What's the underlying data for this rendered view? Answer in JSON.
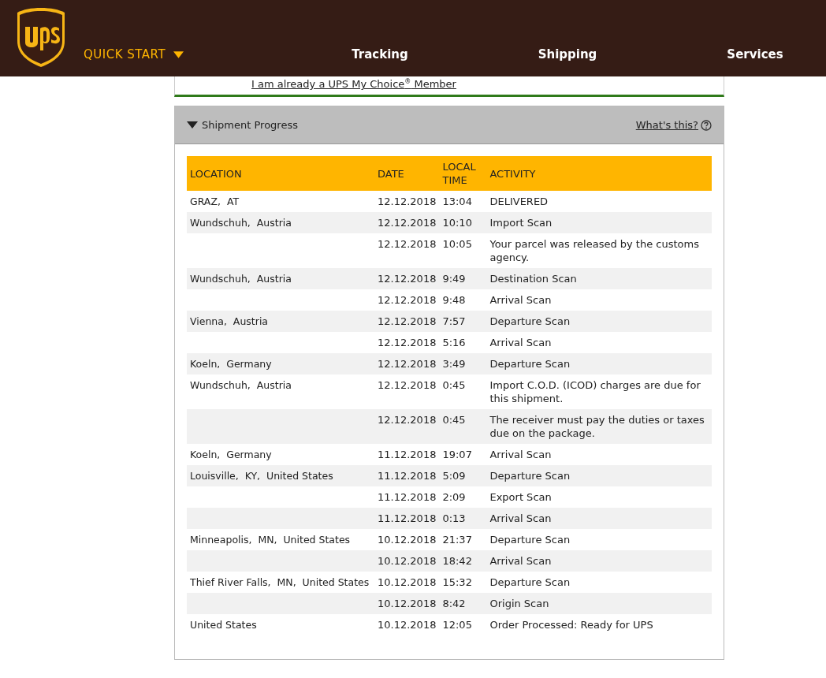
{
  "header": {
    "quick_start": "QUICK START",
    "nav": [
      {
        "label": "Tracking"
      },
      {
        "label": "Shipping"
      },
      {
        "label": "Services"
      }
    ]
  },
  "member_link": "I am already a UPS My Choice$^{®}$ Member",
  "progress": {
    "title": "Shipment Progress",
    "expanded": true,
    "help_link": "What's this?",
    "columns": [
      "LOCATION",
      "DATE",
      "LOCAL TIME",
      "ACTIVITY"
    ],
    "rows": [
      {
        "location": "GRAZ,  AT",
        "date": "12.12.2018",
        "time": "13:04",
        "activity": "DELIVERED"
      },
      {
        "location": "Wundschuh,  Austria",
        "date": "12.12.2018",
        "time": "10:10",
        "activity": "Import Scan"
      },
      {
        "date": "12.12.2018",
        "time": "10:05",
        "activity": "Your parcel was released by the customs agency."
      },
      {
        "location": "Wundschuh,  Austria",
        "date": "12.12.2018",
        "time": "9:49",
        "activity": "Destination Scan"
      },
      {
        "date": "12.12.2018",
        "time": "9:48",
        "activity": "Arrival Scan"
      },
      {
        "location": "Vienna,  Austria",
        "date": "12.12.2018",
        "time": "7:57",
        "activity": "Departure Scan"
      },
      {
        "date": "12.12.2018",
        "time": "5:16",
        "activity": "Arrival Scan"
      },
      {
        "location": "Koeln,  Germany",
        "date": "12.12.2018",
        "time": "3:49",
        "activity": "Departure Scan"
      },
      {
        "location": "Wundschuh,  Austria",
        "date": "12.12.2018",
        "time": "0:45",
        "activity": "Import C.O.D. (ICOD) charges are due for this shipment."
      },
      {
        "date": "12.12.2018",
        "time": "0:45",
        "activity": "The receiver must pay the duties or taxes due on the package."
      },
      {
        "location": "Koeln,  Germany",
        "date": "11.12.2018",
        "time": "19:07",
        "activity": "Arrival Scan"
      },
      {
        "location": "Louisville,  KY,  United States",
        "date": "11.12.2018",
        "time": "5:09",
        "activity": "Departure Scan"
      },
      {
        "date": "11.12.2018",
        "time": "2:09",
        "activity": "Export Scan"
      },
      {
        "date": "11.12.2018",
        "time": "0:13",
        "activity": "Arrival Scan"
      },
      {
        "location": "Minneapolis,  MN,  United States",
        "date": "10.12.2018",
        "time": "21:37",
        "activity": "Departure Scan"
      },
      {
        "date": "10.12.2018",
        "time": "18:42",
        "activity": "Arrival Scan"
      },
      {
        "location": "Thief River Falls,  MN,  United States",
        "date": "10.12.2018",
        "time": "15:32",
        "activity": "Departure Scan"
      },
      {
        "date": "10.12.2018",
        "time": "8:42",
        "activity": "Origin Scan"
      },
      {
        "location": "United States",
        "date": "10.12.2018",
        "time": "12:05",
        "activity": "Order Processed: Ready for UPS"
      }
    ]
  }
}
